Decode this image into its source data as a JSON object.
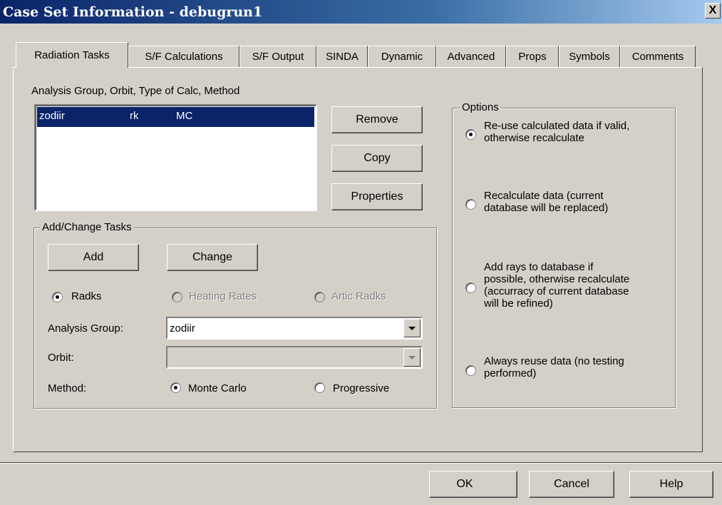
{
  "window": {
    "title": "Case Set Information - debugrun1",
    "close_label": "X"
  },
  "tabs": [
    {
      "label": "Radiation Tasks"
    },
    {
      "label": "S/F Calculations"
    },
    {
      "label": "S/F Output"
    },
    {
      "label": "SINDA"
    },
    {
      "label": "Dynamic"
    },
    {
      "label": "Advanced"
    },
    {
      "label": "Props"
    },
    {
      "label": "Symbols"
    },
    {
      "label": "Comments"
    }
  ],
  "tasks": {
    "list_header": "Analysis Group, Orbit, Type of Calc, Method",
    "rows": [
      {
        "group": "zodiir",
        "orbit": "rk",
        "method": "MC"
      }
    ],
    "remove_label": "Remove",
    "copy_label": "Copy",
    "properties_label": "Properties"
  },
  "add_change": {
    "title": "Add/Change Tasks",
    "add_label": "Add",
    "change_label": "Change",
    "calc_types": [
      "Radks",
      "Heating Rates",
      "Artic Radks"
    ],
    "analysis_group_label": "Analysis Group:",
    "analysis_group_value": "zodiir",
    "orbit_label": "Orbit:",
    "orbit_value": "",
    "method_label": "Method:",
    "methods": [
      "Monte Carlo",
      "Progressive"
    ]
  },
  "options": {
    "title": "Options",
    "items": [
      {
        "line1": "Re-use calculated data if valid,",
        "line2": "otherwise recalculate"
      },
      {
        "line1": "Recalculate data (current",
        "line2": "database will be replaced)"
      },
      {
        "line1": "Add rays to database if",
        "line2": "possible, otherwise recalculate",
        "line3": "(accurracy of current database",
        "line4": "will be refined)"
      },
      {
        "line1": "Always reuse data (no testing",
        "line2": "performed)"
      }
    ]
  },
  "footer": {
    "ok_label": "OK",
    "cancel_label": "Cancel",
    "help_label": "Help"
  }
}
